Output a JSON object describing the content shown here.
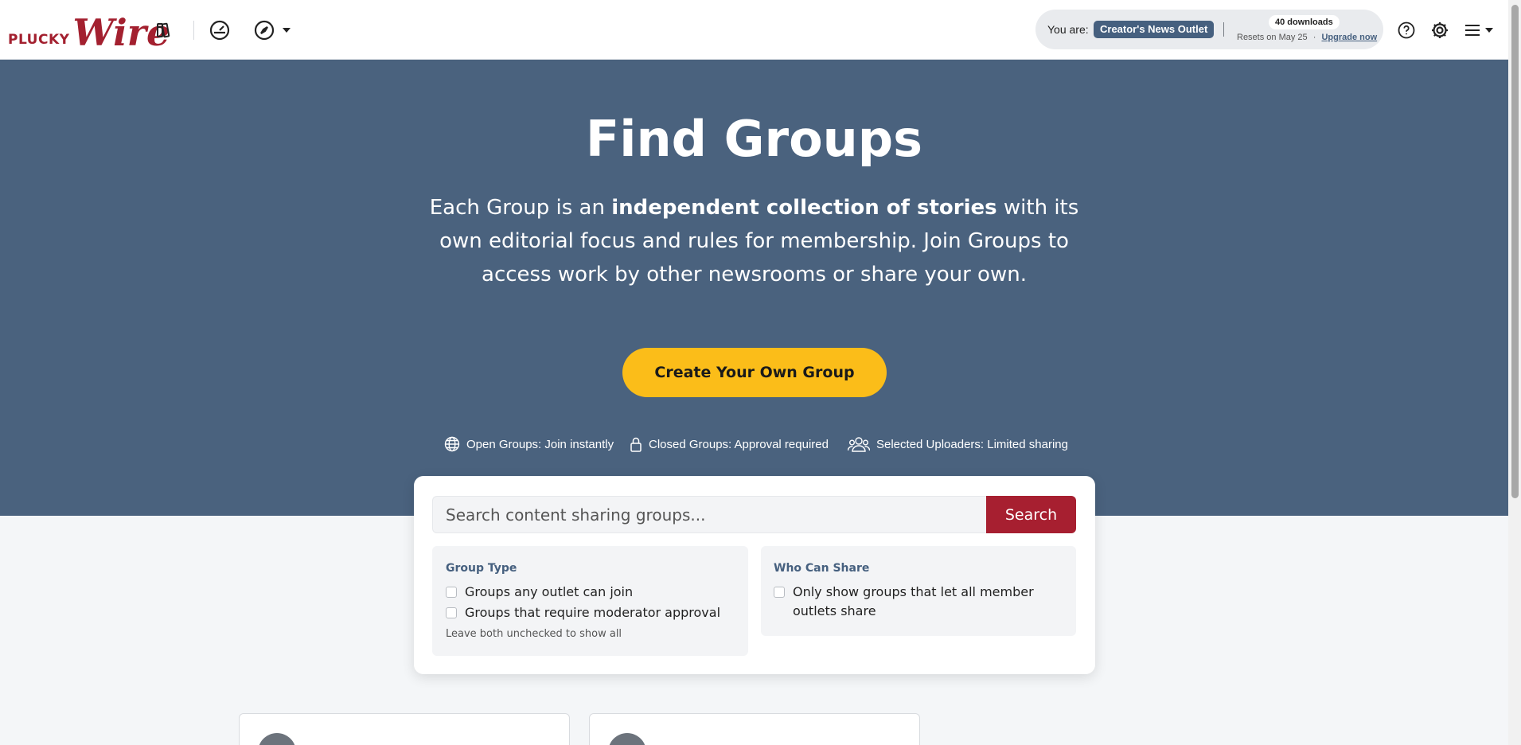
{
  "header": {
    "logo_small": "PLUCKY",
    "logo_big": "Wire",
    "icons": [
      "library-icon",
      "dashboard-icon",
      "explore-icon",
      "help-icon",
      "settings-icon",
      "menu-icon"
    ],
    "you_are_label": "You are:",
    "outlet_name": "Creator's News Outlet",
    "downloads": "40 downloads",
    "resets_text": "Resets on May 25",
    "separator_dot": "·",
    "upgrade_link": "Upgrade now"
  },
  "hero": {
    "title": "Find Groups",
    "desc_before": "Each Group is an ",
    "desc_bold": "independent collection of stories",
    "desc_after": " with its own editorial focus and rules for membership. Join Groups to access work by other newsrooms or share your own.",
    "create_button": "Create Your Own Group",
    "legend": [
      {
        "icon": "globe-icon",
        "text": "Open Groups: Join instantly"
      },
      {
        "icon": "lock-icon",
        "text": "Closed Groups: Approval required"
      },
      {
        "icon": "users-icon",
        "text": "Selected Uploaders: Limited sharing"
      }
    ]
  },
  "search": {
    "placeholder": "Search content sharing groups...",
    "value": "",
    "button": "Search"
  },
  "filters": {
    "group_type": {
      "title": "Group Type",
      "options": [
        {
          "label": "Groups any outlet can join",
          "checked": false
        },
        {
          "label": "Groups that require moderator approval",
          "checked": false
        }
      ],
      "hint": "Leave both unchecked to show all"
    },
    "who_can_share": {
      "title": "Who Can Share",
      "options": [
        {
          "label": "Only show groups that let all member outlets share",
          "checked": false
        }
      ]
    }
  },
  "colors": {
    "brand_red": "#a3202f",
    "hero_bg": "#4a627e",
    "accent_yellow": "#fbbd19",
    "badge_blue": "#46607f"
  }
}
